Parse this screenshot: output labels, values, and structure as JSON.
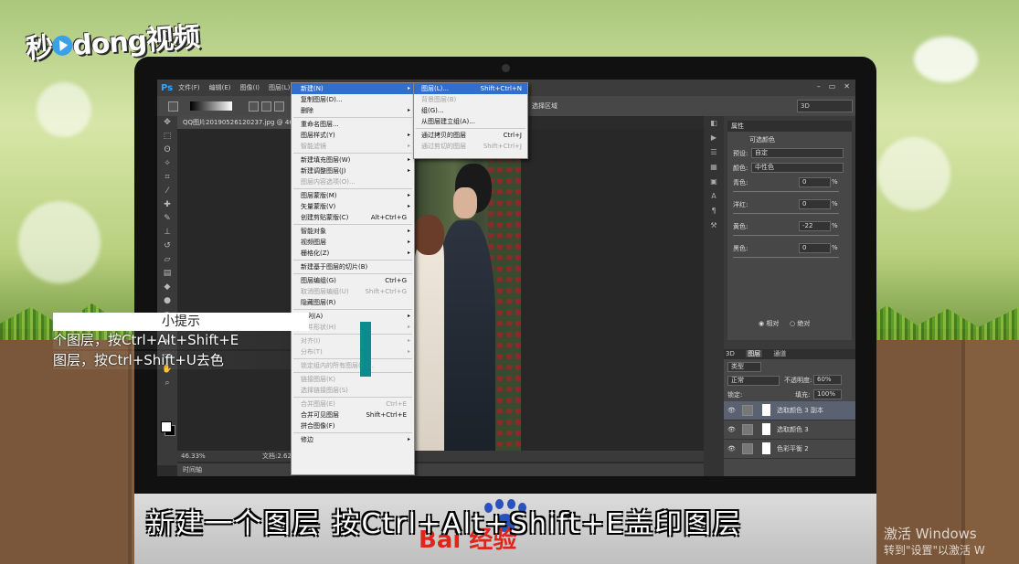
{
  "watermark_logo": {
    "part1": "秒",
    "part2": "dong",
    "part3": "视频"
  },
  "photoshop": {
    "menubar": {
      "app_icon": "Ps",
      "items": [
        "文件(F)",
        "编辑(E)",
        "图像(I)",
        "图层(L)"
      ],
      "window_buttons": [
        "–",
        "▭",
        "✕"
      ]
    },
    "options_bar": {
      "right_text": "选择区域",
      "mode_3d": "3D"
    },
    "document_tab": "QQ图片20190526120237.jpg @ 46.3%",
    "status": {
      "zoom": "46.33%",
      "doc_size": "文档:2.62M/6.60M"
    },
    "timeline_label": "时间轴",
    "layer_menu": [
      {
        "label": "新建(N)",
        "arrow": "▸",
        "selected": true
      },
      {
        "label": "复制图层(D)...",
        "dim": false
      },
      {
        "label": "删除",
        "arrow": "▸"
      },
      {
        "sep": true
      },
      {
        "label": "重命名图层..."
      },
      {
        "label": "图层样式(Y)",
        "arrow": "▸"
      },
      {
        "label": "智能滤镜",
        "arrow": "▸",
        "dim": true
      },
      {
        "sep": true
      },
      {
        "label": "新建填充图层(W)",
        "arrow": "▸"
      },
      {
        "label": "新建调整图层(J)",
        "arrow": "▸"
      },
      {
        "label": "图层内容选项(O)...",
        "dim": true
      },
      {
        "sep": true
      },
      {
        "label": "图层蒙版(M)",
        "arrow": "▸"
      },
      {
        "label": "矢量蒙版(V)",
        "arrow": "▸"
      },
      {
        "label": "创建剪贴蒙版(C)",
        "shortcut": "Alt+Ctrl+G"
      },
      {
        "sep": true
      },
      {
        "label": "智能对象",
        "arrow": "▸"
      },
      {
        "label": "视频图层",
        "arrow": "▸"
      },
      {
        "label": "栅格化(Z)",
        "arrow": "▸"
      },
      {
        "sep": true
      },
      {
        "label": "新建基于图层的切片(B)"
      },
      {
        "sep": true
      },
      {
        "label": "图层编组(G)",
        "shortcut": "Ctrl+G"
      },
      {
        "label": "取消图层编组(U)",
        "shortcut": "Shift+Ctrl+G",
        "dim": true
      },
      {
        "label": "隐藏图层(R)"
      },
      {
        "sep": true
      },
      {
        "label": "排列(A)",
        "arrow": "▸"
      },
      {
        "label": "合并形状(H)",
        "arrow": "▸",
        "dim": true
      },
      {
        "sep": true
      },
      {
        "label": "对齐(I)",
        "arrow": "▸",
        "dim": true
      },
      {
        "label": "分布(T)",
        "arrow": "▸",
        "dim": true
      },
      {
        "sep": true
      },
      {
        "label": "锁定组内的所有图层(X)...",
        "dim": true
      },
      {
        "sep": true
      },
      {
        "label": "链接图层(K)",
        "dim": true
      },
      {
        "label": "选择链接图层(S)",
        "dim": true
      },
      {
        "sep": true
      },
      {
        "label": "合并图层(E)",
        "shortcut": "Ctrl+E",
        "dim": true
      },
      {
        "label": "合并可见图层",
        "shortcut": "Shift+Ctrl+E"
      },
      {
        "label": "拼合图像(F)"
      },
      {
        "sep": true
      },
      {
        "label": "修边",
        "arrow": "▸"
      }
    ],
    "new_submenu": [
      {
        "label": "图层(L)...",
        "shortcut": "Shift+Ctrl+N",
        "selected": true
      },
      {
        "label": "背景图层(B)",
        "dim": true
      },
      {
        "label": "组(G)..."
      },
      {
        "label": "从图层建立组(A)..."
      },
      {
        "sep": true
      },
      {
        "label": "通过拷贝的图层",
        "shortcut": "Ctrl+J"
      },
      {
        "label": "通过剪切的图层",
        "shortcut": "Shift+Ctrl+J",
        "dim": true
      }
    ],
    "properties": {
      "tab": "属性",
      "title": "可选颜色",
      "preset_label": "预设:",
      "preset_value": "自定",
      "color_label": "颜色:",
      "color_value": "中性色",
      "rows": [
        {
          "label": "青色:",
          "value": "0",
          "unit": "%"
        },
        {
          "label": "洋红:",
          "value": "0",
          "unit": "%"
        },
        {
          "label": "黄色:",
          "value": "-22",
          "unit": "%"
        },
        {
          "label": "黑色:",
          "value": "0",
          "unit": "%"
        }
      ],
      "radio_relative": "相对",
      "radio_absolute": "绝对"
    },
    "layers_panel": {
      "tabs": [
        "3D",
        "图层",
        "通道"
      ],
      "filter_label": "类型",
      "blend_mode": "正常",
      "opacity_label": "不透明度:",
      "opacity_value": "60%",
      "lock_label": "锁定:",
      "fill_label": "填充:",
      "fill_value": "100%",
      "layers": [
        {
          "name": "选取颜色 3 副本",
          "active": true
        },
        {
          "name": "选取颜色 3",
          "active": false
        },
        {
          "name": "色彩平衡 2",
          "active": false
        }
      ]
    }
  },
  "tip_box": {
    "heading": "小提示",
    "line1": "个图层，按Ctrl+Alt+Shift+E",
    "line2": "图层，按Ctrl+Shift+U去色"
  },
  "caption": "新建一个图层 按Ctrl+Alt+Shift+E盖印图层",
  "baidu_logo_text": "Bai 经验",
  "windows_watermark": {
    "line1": "激活 Windows",
    "line2": "转到\"设置\"以激活 W"
  },
  "colors": {
    "menu_highlight": "#2f6fd0",
    "ps_blue": "#31a8ff",
    "tip_teal": "#0b8b8b"
  }
}
